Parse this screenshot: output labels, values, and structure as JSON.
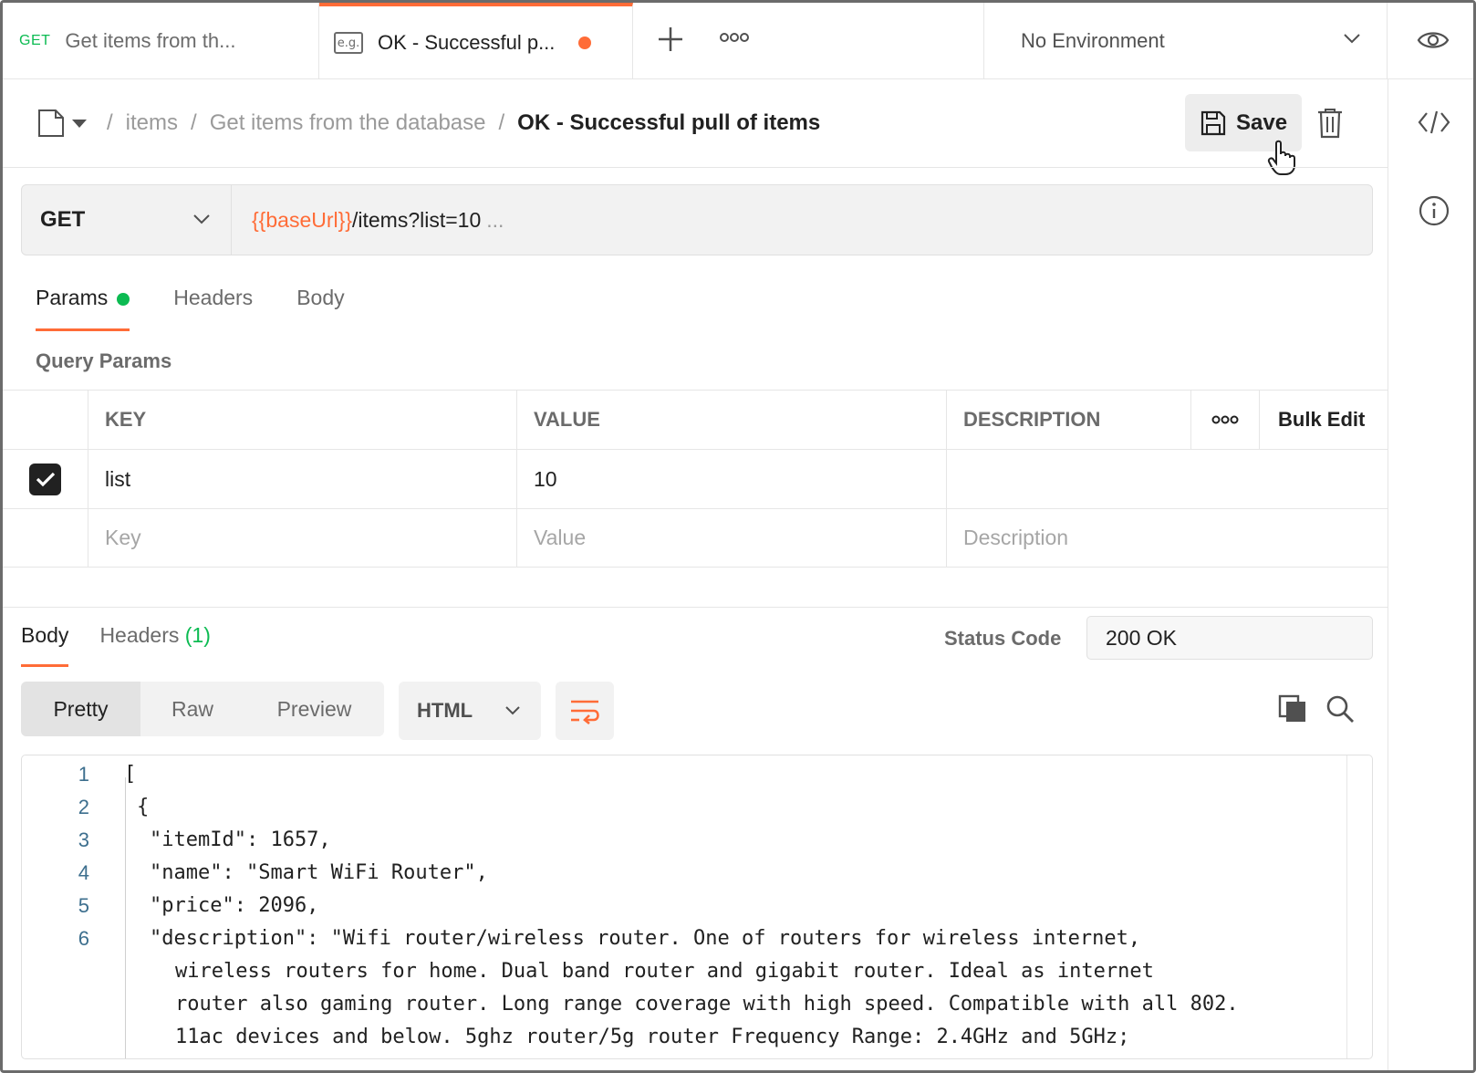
{
  "tabs": [
    {
      "method": "GET",
      "title": "Get items from th..."
    },
    {
      "badge": "e.g.",
      "title": "OK - Successful p..."
    }
  ],
  "environment": {
    "selected": "No Environment"
  },
  "breadcrumb": {
    "items": [
      "items",
      "Get items from the database"
    ],
    "current": "OK - Successful pull of items",
    "separator": "/"
  },
  "toolbar": {
    "save_label": "Save"
  },
  "request": {
    "method": "GET",
    "url_var": "{{baseUrl}}",
    "url_path": "/items?list=10",
    "url_ellipsis": "..."
  },
  "request_tabs": [
    {
      "label": "Params"
    },
    {
      "label": "Headers"
    },
    {
      "label": "Body"
    }
  ],
  "query_params": {
    "title": "Query Params",
    "headers": {
      "key": "KEY",
      "value": "VALUE",
      "description": "DESCRIPTION",
      "bulk_edit": "Bulk Edit"
    },
    "rows": [
      {
        "key": "list",
        "value": "10",
        "description": ""
      }
    ],
    "placeholders": {
      "key": "Key",
      "value": "Value",
      "description": "Description"
    }
  },
  "response": {
    "tabs": [
      {
        "label": "Body"
      },
      {
        "label": "Headers",
        "count": "(1)"
      }
    ],
    "status_label": "Status Code",
    "status_value": "200 OK",
    "view_modes": [
      "Pretty",
      "Raw",
      "Preview"
    ],
    "format": "HTML",
    "code_lines": [
      {
        "num": "1",
        "text": "["
      },
      {
        "num": "2",
        "text": "{"
      },
      {
        "num": "3",
        "text": "\"itemId\": 1657,"
      },
      {
        "num": "4",
        "text": "\"name\": \"Smart WiFi Router\","
      },
      {
        "num": "5",
        "text": "\"price\": 2096,"
      },
      {
        "num": "6",
        "text": "\"description\": \"Wifi router/wireless router. One of routers for wireless internet,"
      },
      {
        "num": "",
        "text": "wireless routers for home. Dual band router and gigabit router. Ideal as internet"
      },
      {
        "num": "",
        "text": "router also gaming router. Long range coverage with high speed. Compatible with all 802."
      },
      {
        "num": "",
        "text": "11ac devices and below. 5ghz router/5g router Frequency Range: 2.4GHz and 5GHz;"
      }
    ]
  },
  "colors": {
    "accent": "#ff6c37",
    "success": "#0cbb52"
  }
}
